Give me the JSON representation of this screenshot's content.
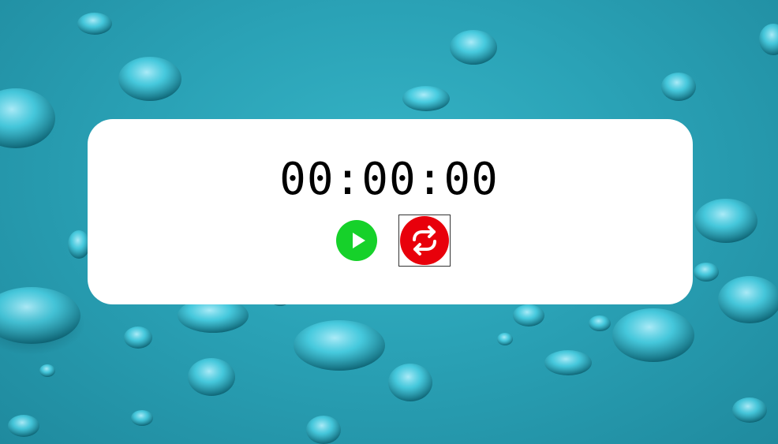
{
  "stopwatch": {
    "time": "00:00:00"
  },
  "controls": {
    "play_icon": "play-icon",
    "reset_icon": "refresh-icon",
    "play_color": "#16d12a",
    "reset_color": "#e8000b"
  },
  "colors": {
    "background": "#2aa2b6",
    "card": "#ffffff",
    "text": "#000000"
  }
}
